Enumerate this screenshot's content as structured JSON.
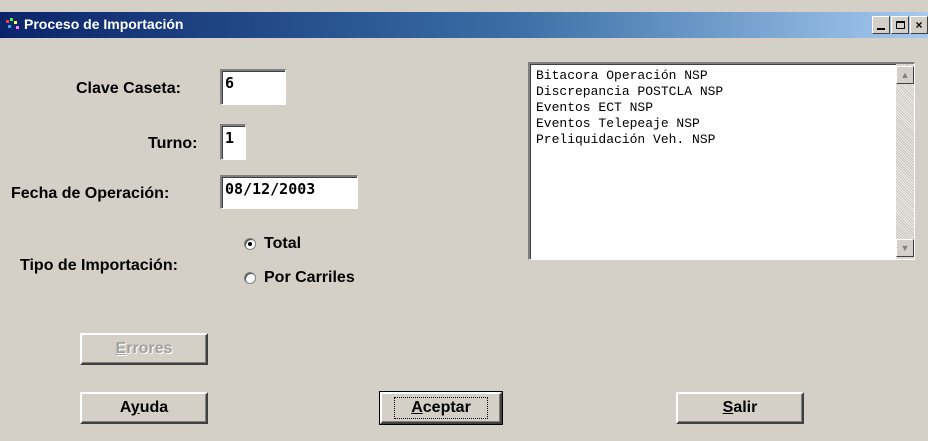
{
  "window": {
    "title": "Proceso de Importación"
  },
  "fields": {
    "clave_caseta_label": "Clave Caseta:",
    "clave_caseta_value": "6",
    "turno_label": "Turno:",
    "turno_value": "1",
    "fecha_label": "Fecha de Operación:",
    "fecha_value": "08/12/2003",
    "tipo_label": "Tipo de Importación:"
  },
  "radios": {
    "total_label": "Total",
    "por_carriles_label": "Por Carriles",
    "selected": "Total"
  },
  "list": {
    "items": [
      "Bitacora Operación NSP",
      "Discrepancia POSTCLA NSP",
      "Eventos ECT NSP",
      "Eventos Telepeaje NSP",
      "Preliquidación Veh. NSP"
    ]
  },
  "buttons": {
    "errores_first": "E",
    "errores_rest": "rrores",
    "ayuda_pre": "A",
    "ayuda_u": "y",
    "ayuda_post": "uda",
    "aceptar_u": "A",
    "aceptar_rest": "ceptar",
    "salir_u": "S",
    "salir_rest": "alir"
  },
  "colors": {
    "titlebar_start": "#0a246a",
    "titlebar_end": "#a6caf0",
    "face": "#d4d0c8"
  },
  "icons": [
    "app-icon",
    "minimize-icon",
    "maximize-icon",
    "close-icon",
    "scroll-up-arrow-icon",
    "scroll-down-arrow-icon"
  ]
}
